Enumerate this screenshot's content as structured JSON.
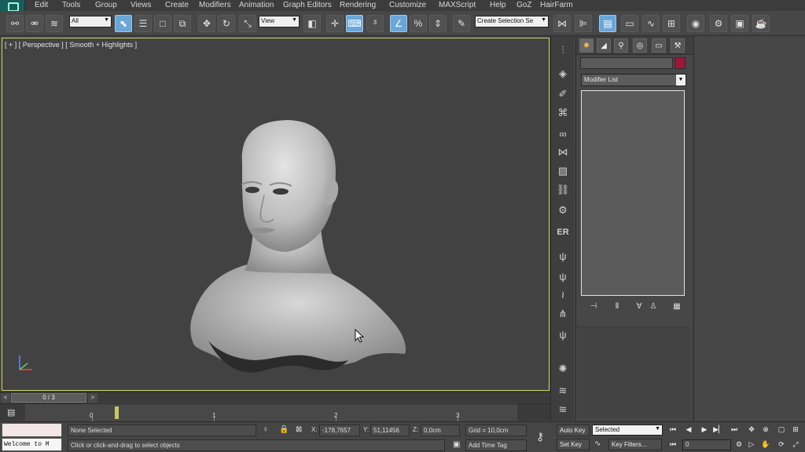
{
  "menu": [
    "Edit",
    "Tools",
    "Group",
    "Views",
    "Create",
    "Modifiers",
    "Animation",
    "Graph Editors",
    "Rendering",
    "Customize",
    "MAXScript",
    "Help",
    "GoZ",
    "HairFarm"
  ],
  "toolbar": {
    "selection_filter": "All",
    "reference_coord": "View",
    "named_selection": "Create Selection Se",
    "icons": [
      "link-icon",
      "unlink-icon",
      "bind-space-warp-icon",
      "select-object-icon",
      "select-by-name-icon",
      "rect-region-icon",
      "window-crossing-icon",
      "move-icon",
      "rotate-icon",
      "scale-icon",
      "pivot-icon",
      "manipulate-icon",
      "keyboard-shortcut-icon",
      "snap-icon",
      "angle-snap-icon",
      "percent-snap-icon",
      "spinner-snap-icon",
      "edit-named-sets-icon",
      "mirror-icon",
      "align-icon",
      "layer-manager-icon",
      "ribbon-icon",
      "curve-editor-icon",
      "schematic-view-icon",
      "material-editor-icon",
      "render-setup-icon",
      "rendered-frame-icon",
      "render-icon"
    ]
  },
  "viewport": {
    "label": "[ + ] [ Perspective ] [ Smooth + Highlights ]"
  },
  "command_panel": {
    "tabs": [
      "create-icon",
      "modify-icon",
      "hierarchy-icon",
      "motion-icon",
      "display-icon",
      "utilities-icon"
    ],
    "object_name": "",
    "object_color": "#9e1738",
    "modifier_list": "Modifier List",
    "stack_tools": [
      "pin-stack-icon",
      "show-end-result-icon",
      "make-unique-icon",
      "remove-modifier-icon",
      "configure-modifier-sets-icon"
    ]
  },
  "side_toolbar": {
    "icons": [
      "hair-icon",
      "cube-icon",
      "brush-icon",
      "comb-icon",
      "knot-icon",
      "bowtie-icon",
      "box-icon",
      "chain-icon",
      "gear-icon",
      "er-icon",
      "grass-icon",
      "grass-2-icon",
      "grass-3-icon",
      "grass-4-icon",
      "grass-5-icon",
      "light-icon",
      "wave-icon",
      "wave-2-icon"
    ],
    "er_label": "ER"
  },
  "timeslider": {
    "position": "0 / 3",
    "frame_start": 0,
    "frame_end": 3
  },
  "trackbar": {
    "ticks": [
      "0",
      "1",
      "2",
      "3"
    ]
  },
  "status": {
    "maxscript_listener": "Welcome to M",
    "selection": "None Selected",
    "prompt": "Click or click-and-drag to select objects",
    "x_label": "X:",
    "x_value": "-178,7657",
    "y_label": "Y:",
    "y_value": "51,11456",
    "z_label": "Z:",
    "z_value": "0,0cm",
    "grid": "Grid = 10,0cm",
    "add_time_tag": "Add Time Tag",
    "auto_key": "Auto Key",
    "set_key": "Set Key",
    "selected_option": "Selected",
    "key_filters": "Key Filters...",
    "current_frame": "0"
  }
}
